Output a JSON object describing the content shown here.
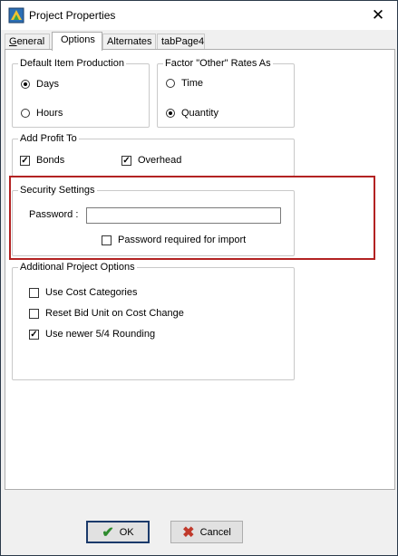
{
  "window": {
    "title": "Project Properties",
    "close_glyph": "✕"
  },
  "tabs": [
    {
      "label": "General",
      "underline": "G",
      "rest": "eneral"
    },
    {
      "label": "Options"
    },
    {
      "label": "Alternates"
    },
    {
      "label": "tabPage4"
    }
  ],
  "default_item_production": {
    "title": "Default Item Production",
    "options": [
      {
        "label": "Days",
        "selected": true
      },
      {
        "label": "Hours",
        "selected": false
      }
    ]
  },
  "factor_other_rates": {
    "title": "Factor \"Other\" Rates As",
    "options": [
      {
        "label": "Time",
        "selected": false
      },
      {
        "label": "Quantity",
        "selected": true
      }
    ]
  },
  "add_profit_to": {
    "title": "Add Profit To",
    "options": [
      {
        "label": "Bonds",
        "checked": true
      },
      {
        "label": "Overhead",
        "checked": true
      }
    ]
  },
  "security_settings": {
    "title": "Security Settings",
    "password_label": "Password :",
    "password_value": "",
    "password_required_label": "Password required for import",
    "password_required_checked": false
  },
  "additional_options": {
    "title": "Additional Project Options",
    "options": [
      {
        "label": "Use Cost Categories",
        "checked": false
      },
      {
        "label": "Reset Bid Unit on Cost Change",
        "checked": false
      },
      {
        "label": "Use newer 5/4 Rounding",
        "checked": true
      }
    ]
  },
  "buttons": {
    "ok_label": "OK",
    "ok_glyph": "✔",
    "cancel_label": "Cancel",
    "cancel_glyph": "✖"
  },
  "colors": {
    "highlight": "#b32222",
    "ok_icon": "#2e8b2e",
    "cancel_icon": "#c0392b"
  }
}
